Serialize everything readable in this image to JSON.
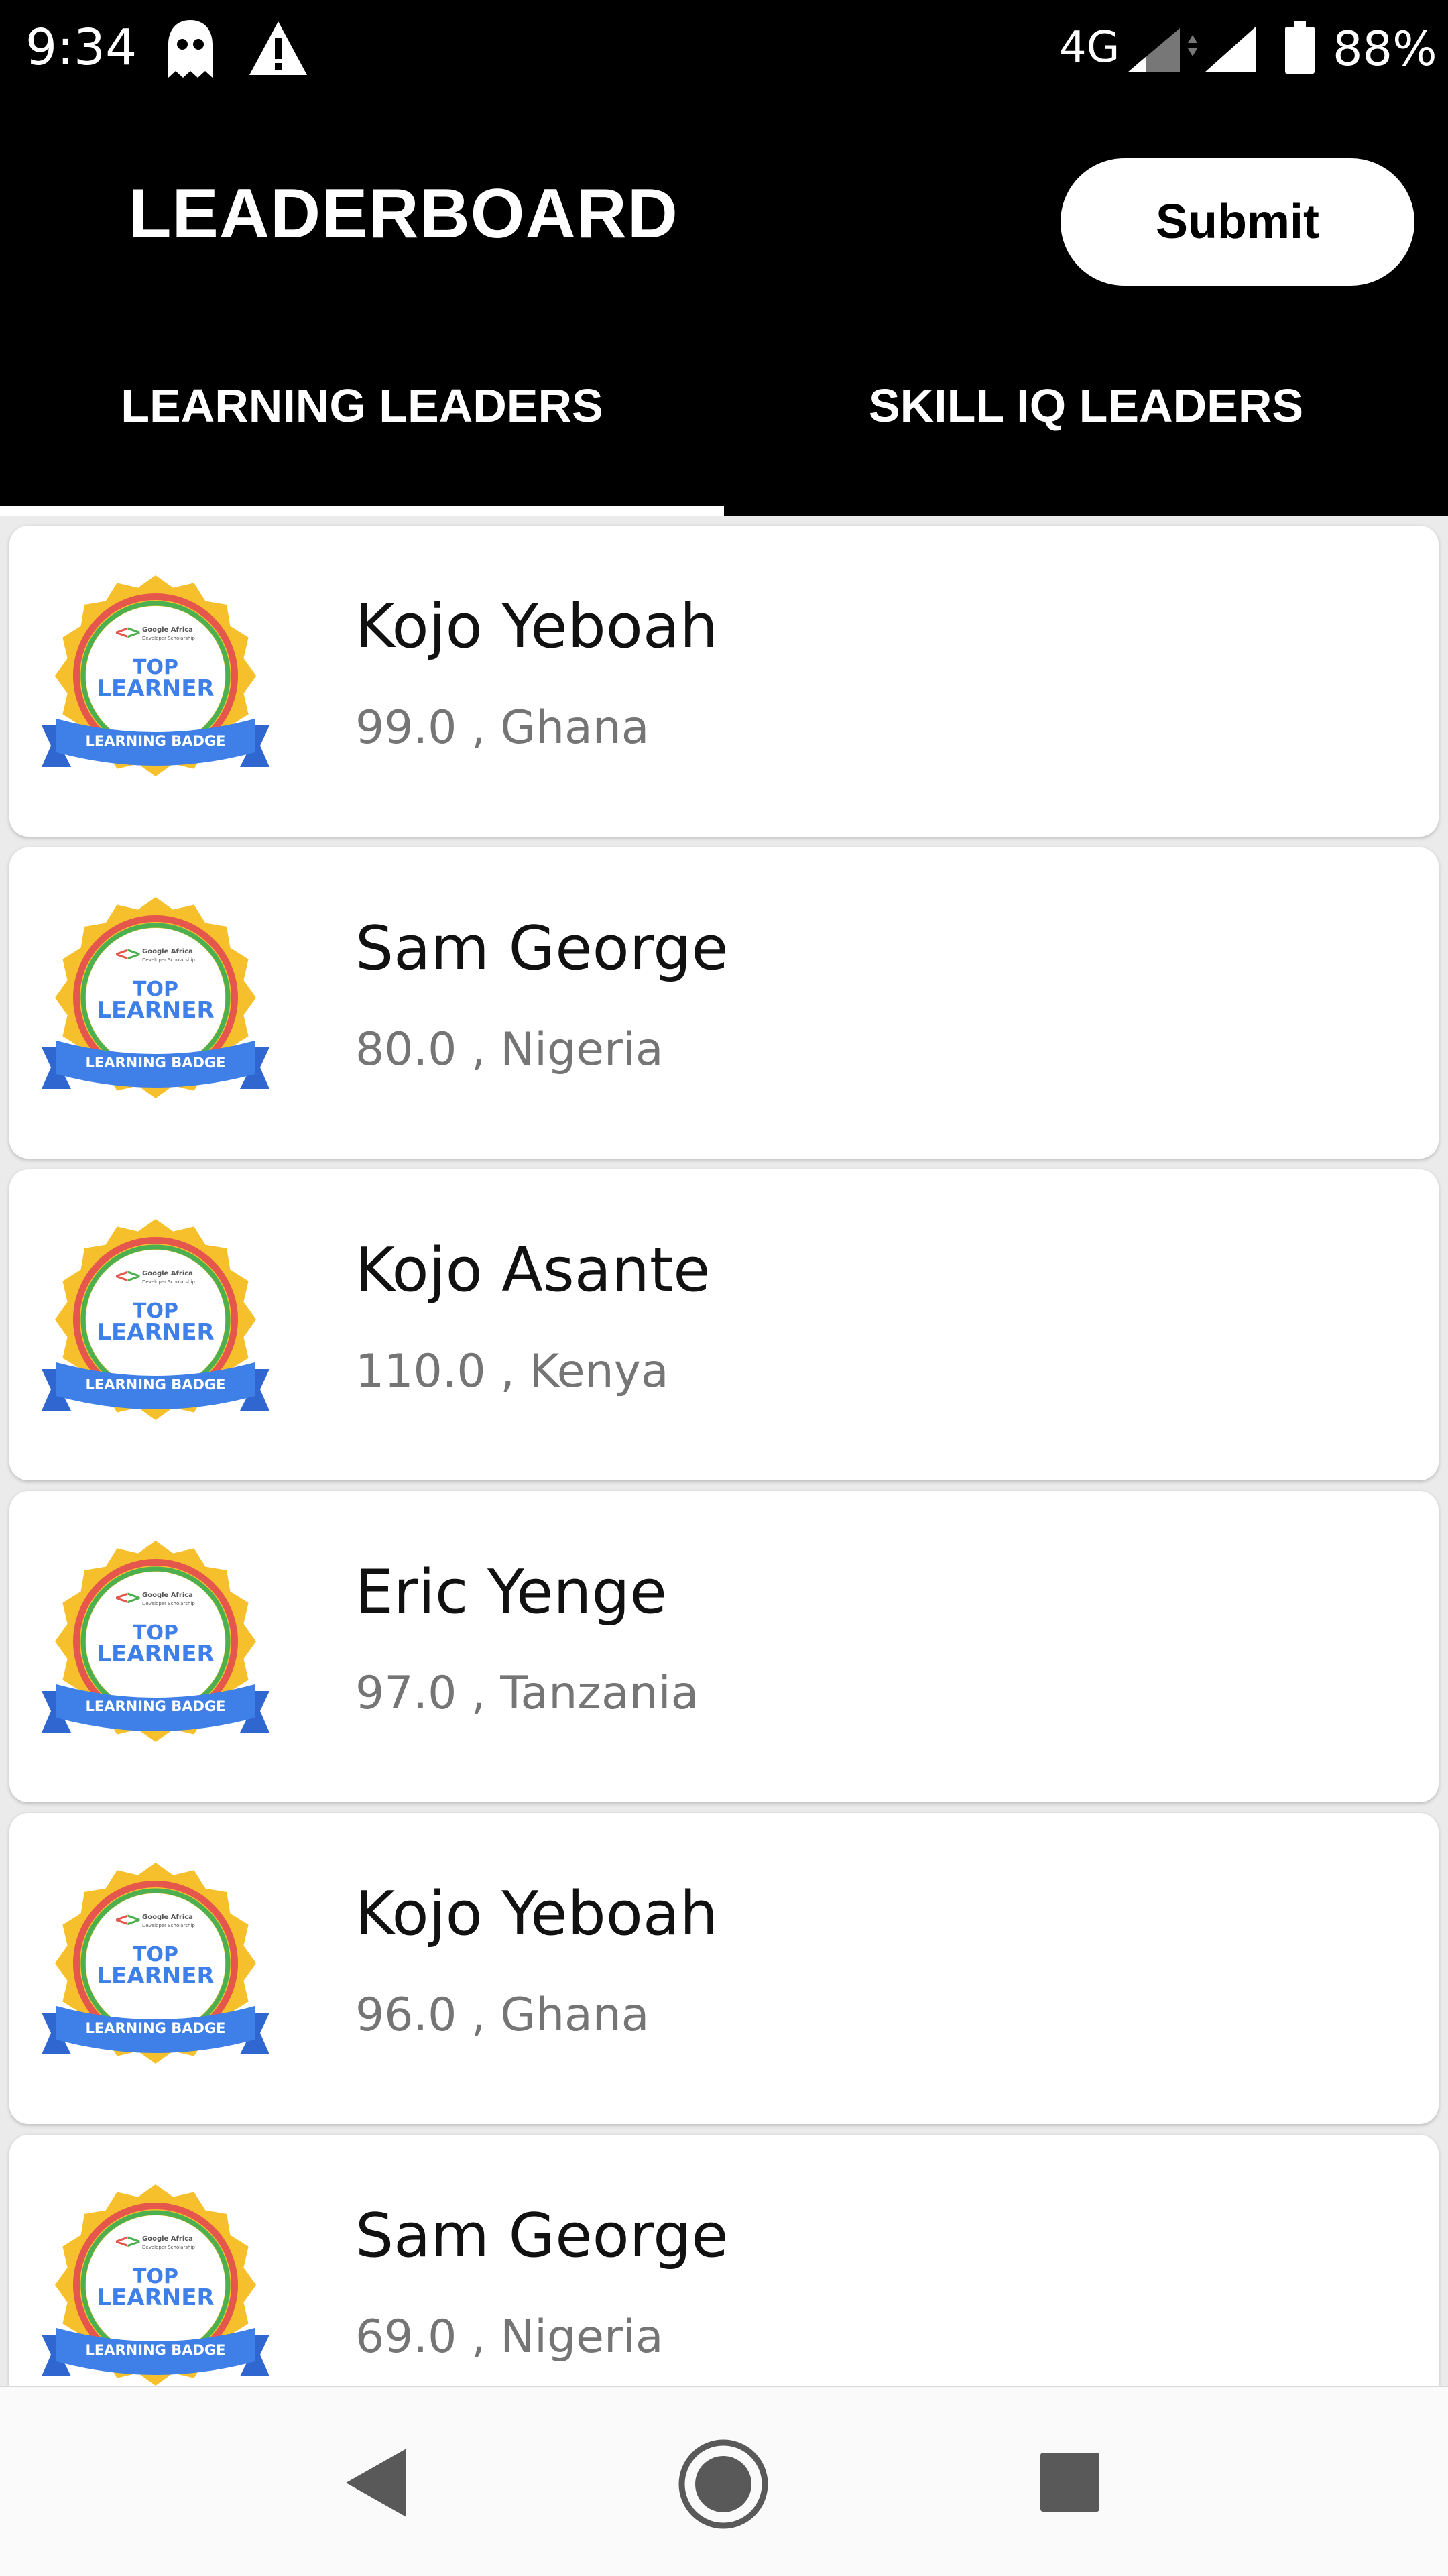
{
  "status_bar": {
    "time": "9:34",
    "network": "4G",
    "battery": "88%",
    "icons": [
      "ghost-icon",
      "warning-icon",
      "cell-signal-icon",
      "wifi-signal-icon",
      "battery-icon"
    ]
  },
  "app_bar": {
    "title": "LEADERBOARD",
    "submit_label": "Submit"
  },
  "tabs": [
    {
      "label": "LEARNING LEADERS",
      "selected": true
    },
    {
      "label": "SKILL IQ LEADERS",
      "selected": false
    }
  ],
  "badge": {
    "line1": "Google Africa",
    "line2": "Developer Scholarship",
    "top": "TOP",
    "learner": "LEARNER",
    "ribbon": "LEARNING BADGE",
    "colors": {
      "gold": "#F6C02C",
      "red": "#E5574C",
      "green": "#4CAF50",
      "blue": "#3F7FE8"
    }
  },
  "leaders": [
    {
      "name": "Kojo Yeboah",
      "detail": "99.0 , Ghana"
    },
    {
      "name": "Sam George",
      "detail": "80.0 , Nigeria"
    },
    {
      "name": "Kojo Asante",
      "detail": "110.0 , Kenya"
    },
    {
      "name": "Eric Yenge",
      "detail": "97.0 , Tanzania"
    },
    {
      "name": "Kojo Yeboah",
      "detail": "96.0 , Ghana"
    },
    {
      "name": "Sam George",
      "detail": "69.0 , Nigeria"
    }
  ],
  "nav": {
    "icons": [
      "back-icon",
      "home-icon",
      "recents-icon"
    ]
  }
}
